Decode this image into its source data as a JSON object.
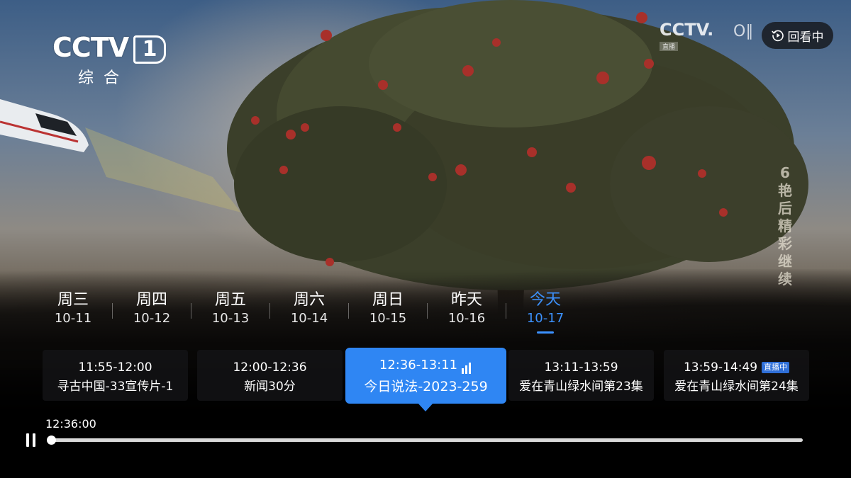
{
  "player": {
    "replay_label": "回看中",
    "current_time": "12:36:00",
    "progress": 0.0,
    "state": "playing"
  },
  "channel": {
    "logo_text": "CCTV",
    "number": "1",
    "name": "综合"
  },
  "watermark": {
    "logo_text": "CCTV.",
    "sub_text": "直播",
    "extra": "O∥"
  },
  "promo_vertical": [
    "6",
    "艳",
    "后",
    "精",
    "彩",
    "继",
    "续"
  ],
  "date_tabs": [
    {
      "day": "周三",
      "date": "10-11",
      "active": false
    },
    {
      "day": "周四",
      "date": "10-12",
      "active": false
    },
    {
      "day": "周五",
      "date": "10-13",
      "active": false
    },
    {
      "day": "周六",
      "date": "10-14",
      "active": false
    },
    {
      "day": "周日",
      "date": "10-15",
      "active": false
    },
    {
      "day": "昨天",
      "date": "10-16",
      "active": false
    },
    {
      "day": "今天",
      "date": "10-17",
      "active": true
    }
  ],
  "programs": [
    {
      "time": "11:55-12:00",
      "title": "寻古中国-33宣传片-1",
      "state": "past"
    },
    {
      "time": "12:00-12:36",
      "title": "新闻30分",
      "state": "past"
    },
    {
      "time": "12:36-13:11",
      "title": "今日说法-2023-259",
      "state": "playing"
    },
    {
      "time": "13:11-13:59",
      "title": "爱在青山绿水间第23集",
      "state": "past"
    },
    {
      "time": "13:59-14:49",
      "title": "爱在青山绿水间第24集",
      "state": "live",
      "badge": "直播中"
    }
  ],
  "colors": {
    "accent": "#3c92ff",
    "selected_card": "#2f86f3",
    "live_badge": "#2f6fd8"
  },
  "icons": {
    "replay": "replay-circle-play-icon",
    "playing": "signal-bars-icon",
    "pause": "pause-icon"
  }
}
